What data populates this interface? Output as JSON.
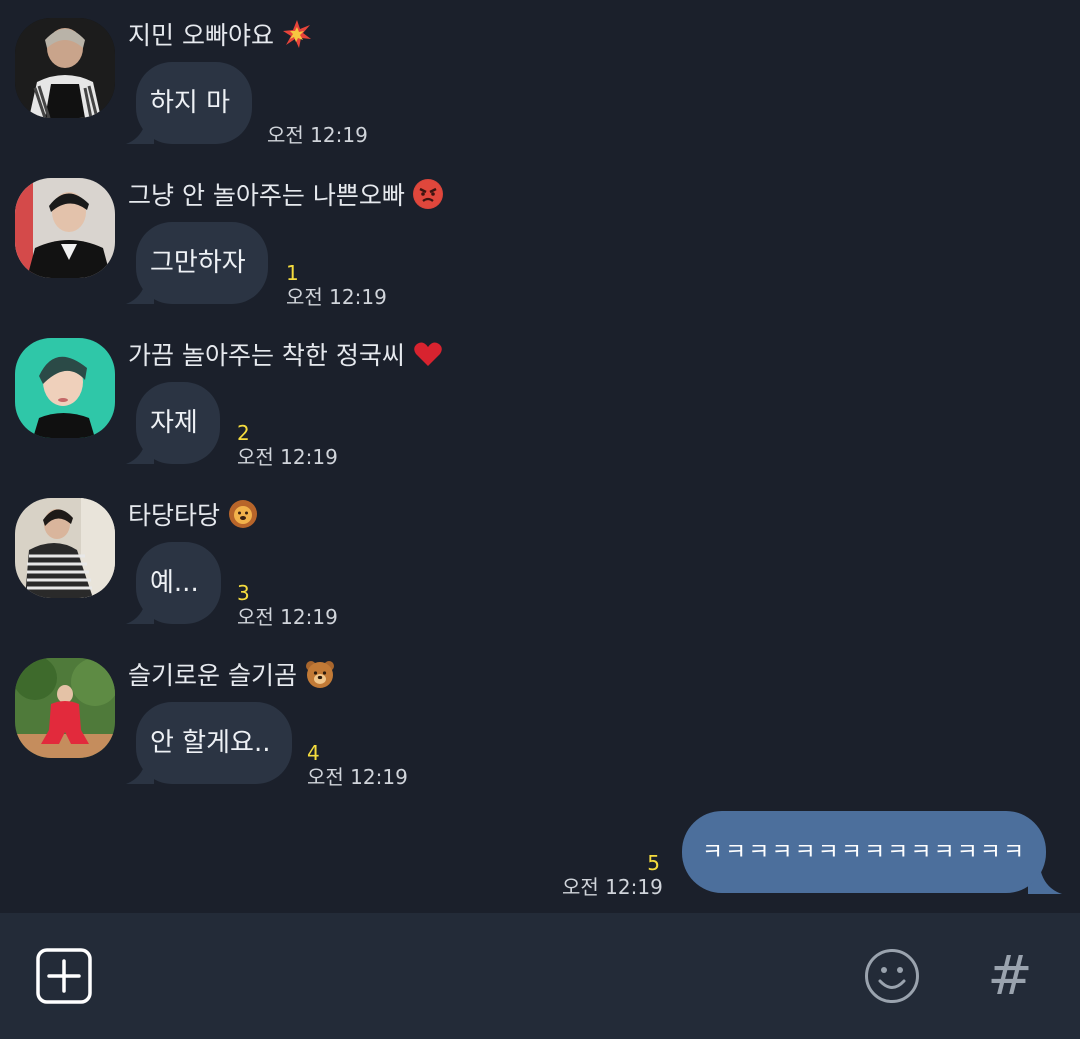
{
  "messages": [
    {
      "sender": "지민 오빠야요",
      "emoji": "collision",
      "text": "하지 마",
      "unread": "",
      "time": "오전 12:19"
    },
    {
      "sender": "그냥 안 놀아주는 나쁜오빠",
      "emoji": "angry-face",
      "text": "그만하자",
      "unread": "1",
      "time": "오전 12:19"
    },
    {
      "sender": "가끔 놀아주는 착한 정국씨",
      "emoji": "red-heart",
      "text": "자제",
      "unread": "2",
      "time": "오전 12:19"
    },
    {
      "sender": "타당타당",
      "emoji": "lion-face",
      "text": "예...",
      "unread": "3",
      "time": "오전 12:19"
    },
    {
      "sender": "슬기로운 슬기곰",
      "emoji": "bear-face",
      "text": "안 할게요..",
      "unread": "4",
      "time": "오전 12:19"
    }
  ],
  "outgoing": {
    "text": "ㅋㅋㅋㅋㅋㅋㅋㅋㅋㅋㅋㅋㅋㅋ",
    "unread": "5",
    "time": "오전 12:19"
  },
  "toolbar": {
    "add_icon": "plus-square-icon",
    "emoticon_icon": "smiley-icon",
    "hashtag_label": "#"
  },
  "colors": {
    "background": "#1b202b",
    "incoming_bubble": "#2b3443",
    "outgoing_bubble": "#4c6f9c",
    "unread_count": "#f5dc3e",
    "toolbar": "#232b38"
  }
}
